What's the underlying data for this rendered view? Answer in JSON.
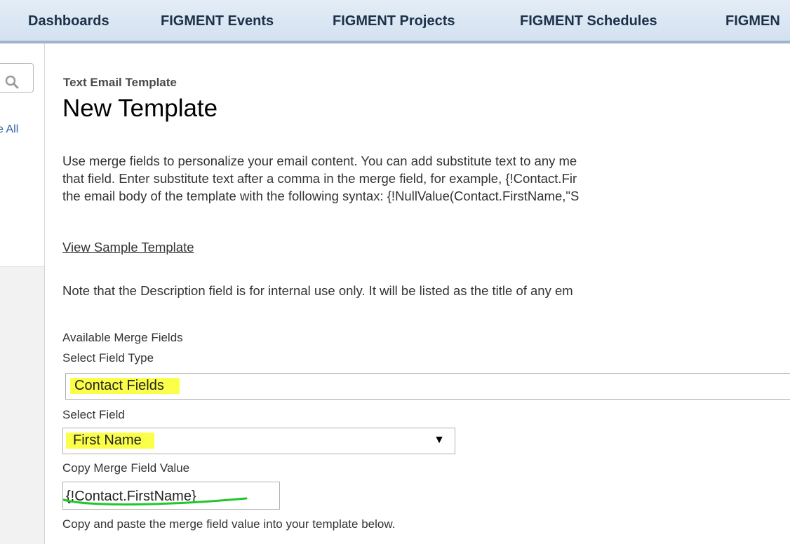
{
  "nav": {
    "tabs": [
      "Dashboards",
      "FIGMENT Events",
      "FIGMENT Projects",
      "FIGMENT Schedules",
      "FIGMEN"
    ]
  },
  "sidebar": {
    "see_all": "e All"
  },
  "header": {
    "subtitle": "Text Email Template",
    "title": "New Template"
  },
  "intro": {
    "line1": "Use merge fields to personalize your email content. You can add substitute text to any me",
    "line2": "that field. Enter substitute text after a comma in the merge field, for example, {!Contact.Fir",
    "line3": "the email body of the template with the following syntax: {!NullValue(Contact.FirstName,\"S"
  },
  "sample_link": "View Sample Template",
  "note": "Note that the Description field is for internal use only. It will be listed as the title of any em",
  "merge": {
    "heading": "Available Merge Fields",
    "field_type_label": "Select Field Type",
    "field_type_value": "Contact Fields",
    "field_label": "Select Field",
    "field_value": "First Name",
    "copy_label": "Copy Merge Field Value",
    "copy_value": "{!Contact.FirstName}",
    "instructions": "Copy and paste the merge field value into your template below."
  },
  "colors": {
    "highlight": "#fbff4a",
    "annotation_underline": "#22c52a",
    "nav_text": "#1d3149"
  },
  "icons": [
    "search-icon",
    "dropdown-arrow-icon"
  ]
}
